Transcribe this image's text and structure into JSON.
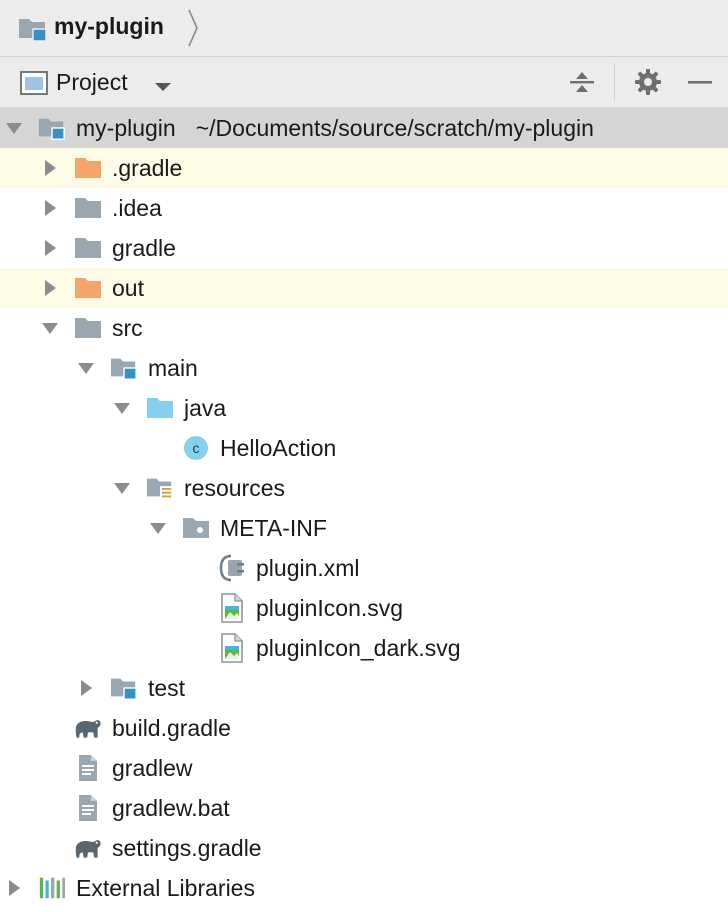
{
  "nav": {
    "crumb": "my-plugin"
  },
  "panel": {
    "title": "Project"
  },
  "tree": [
    {
      "label": "my-plugin",
      "path": "~/Documents/source/scratch/my-plugin",
      "depth": 0,
      "arrow": "down",
      "icon": "module-folder-icon",
      "state": "selected"
    },
    {
      "label": ".gradle",
      "depth": 1,
      "arrow": "right",
      "icon": "excluded-folder-icon",
      "state": "highlight"
    },
    {
      "label": ".idea",
      "depth": 1,
      "arrow": "right",
      "icon": "folder-icon",
      "state": ""
    },
    {
      "label": "gradle",
      "depth": 1,
      "arrow": "right",
      "icon": "folder-icon",
      "state": ""
    },
    {
      "label": "out",
      "depth": 1,
      "arrow": "right",
      "icon": "excluded-folder-icon",
      "state": "highlight"
    },
    {
      "label": "src",
      "depth": 1,
      "arrow": "down",
      "icon": "folder-icon",
      "state": ""
    },
    {
      "label": "main",
      "depth": 2,
      "arrow": "down",
      "icon": "module-folder-icon",
      "state": ""
    },
    {
      "label": "java",
      "depth": 3,
      "arrow": "down",
      "icon": "source-folder-icon",
      "state": ""
    },
    {
      "label": "HelloAction",
      "depth": 4,
      "arrow": "",
      "icon": "java-class-icon",
      "state": ""
    },
    {
      "label": "resources",
      "depth": 3,
      "arrow": "down",
      "icon": "resources-folder-icon",
      "state": ""
    },
    {
      "label": "META-INF",
      "depth": 4,
      "arrow": "down",
      "icon": "package-folder-icon",
      "state": ""
    },
    {
      "label": "plugin.xml",
      "depth": 5,
      "arrow": "",
      "icon": "plugin-xml-icon",
      "state": ""
    },
    {
      "label": "pluginIcon.svg",
      "depth": 5,
      "arrow": "",
      "icon": "image-file-icon",
      "state": ""
    },
    {
      "label": "pluginIcon_dark.svg",
      "depth": 5,
      "arrow": "",
      "icon": "image-file-icon",
      "state": ""
    },
    {
      "label": "test",
      "depth": 2,
      "arrow": "right",
      "icon": "module-folder-icon",
      "state": ""
    },
    {
      "label": "build.gradle",
      "depth": 1,
      "arrow": "",
      "icon": "gradle-icon",
      "state": ""
    },
    {
      "label": "gradlew",
      "depth": 1,
      "arrow": "",
      "icon": "text-file-icon",
      "state": ""
    },
    {
      "label": "gradlew.bat",
      "depth": 1,
      "arrow": "",
      "icon": "text-file-icon",
      "state": ""
    },
    {
      "label": "settings.gradle",
      "depth": 1,
      "arrow": "",
      "icon": "gradle-icon",
      "state": ""
    },
    {
      "label": "External Libraries",
      "depth": 0,
      "arrow": "right",
      "icon": "libraries-icon",
      "state": ""
    }
  ]
}
